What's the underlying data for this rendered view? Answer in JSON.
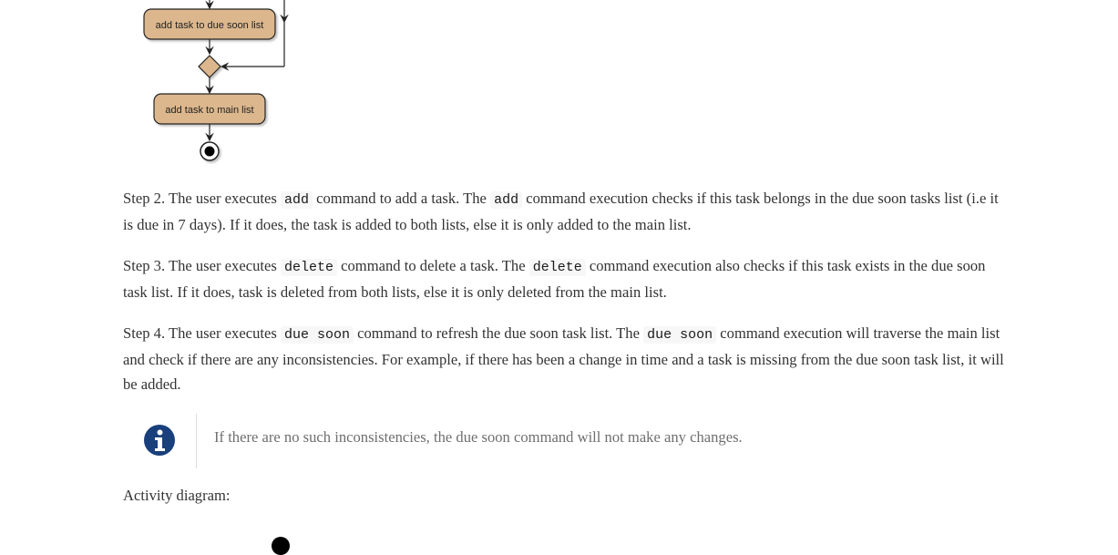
{
  "diagram": {
    "node_due_soon": "add task to due soon list",
    "node_main": "add task to main list"
  },
  "steps": [
    {
      "intro": "Step 2. The user executes ",
      "cmd1": "add",
      "mid": " command to add a task. The ",
      "cmd2": "add",
      "end": " command execution checks if this task belongs in the due soon tasks list (i.e it is due in 7 days). If it does, the task is added to both lists, else it is only added to the main list."
    },
    {
      "intro": "Step 3. The user executes ",
      "cmd1": "delete",
      "mid": " command to delete a task. The ",
      "cmd2": "delete",
      "end": " command execution also checks if this task exists in the due soon task list. If it does, task is deleted from both lists, else it is only deleted from the main list."
    },
    {
      "intro": "Step 4. The user executes ",
      "cmd1": "due soon",
      "mid": " command to refresh the due soon task list. The ",
      "cmd2": "due soon",
      "end": " command execution will traverse the main list and check if there are any inconsistencies. For example, if there has been a change in time and a task is missing from the due soon task list, it will be added."
    }
  ],
  "note": {
    "icon": "info-icon",
    "text": "If there are no such inconsistencies, the due soon command will not make any changes."
  },
  "activity_label": "Activity diagram:",
  "colors": {
    "node_fill": "#dcb78d",
    "info_icon": "#19407c"
  }
}
